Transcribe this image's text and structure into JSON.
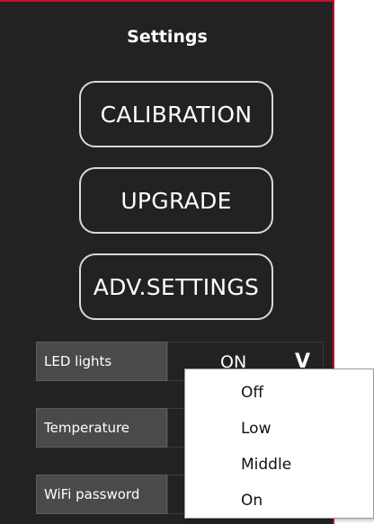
{
  "title": "Settings",
  "buttons": {
    "calibration": "CALIBRATION",
    "upgrade": "UPGRADE",
    "adv_settings": "ADV.SETTINGS"
  },
  "rows": {
    "led": {
      "label": "LED lights",
      "value": "ON"
    },
    "temperature": {
      "label": "Temperature"
    },
    "wifi": {
      "label": "WiFi password"
    }
  },
  "chevron": "V",
  "dropdown": {
    "options": [
      "Off",
      "Low",
      "Middle",
      "On"
    ]
  },
  "colors": {
    "panel": "#222222",
    "accent_border": "#c8102e",
    "label_bg": "#4a4a4a"
  }
}
